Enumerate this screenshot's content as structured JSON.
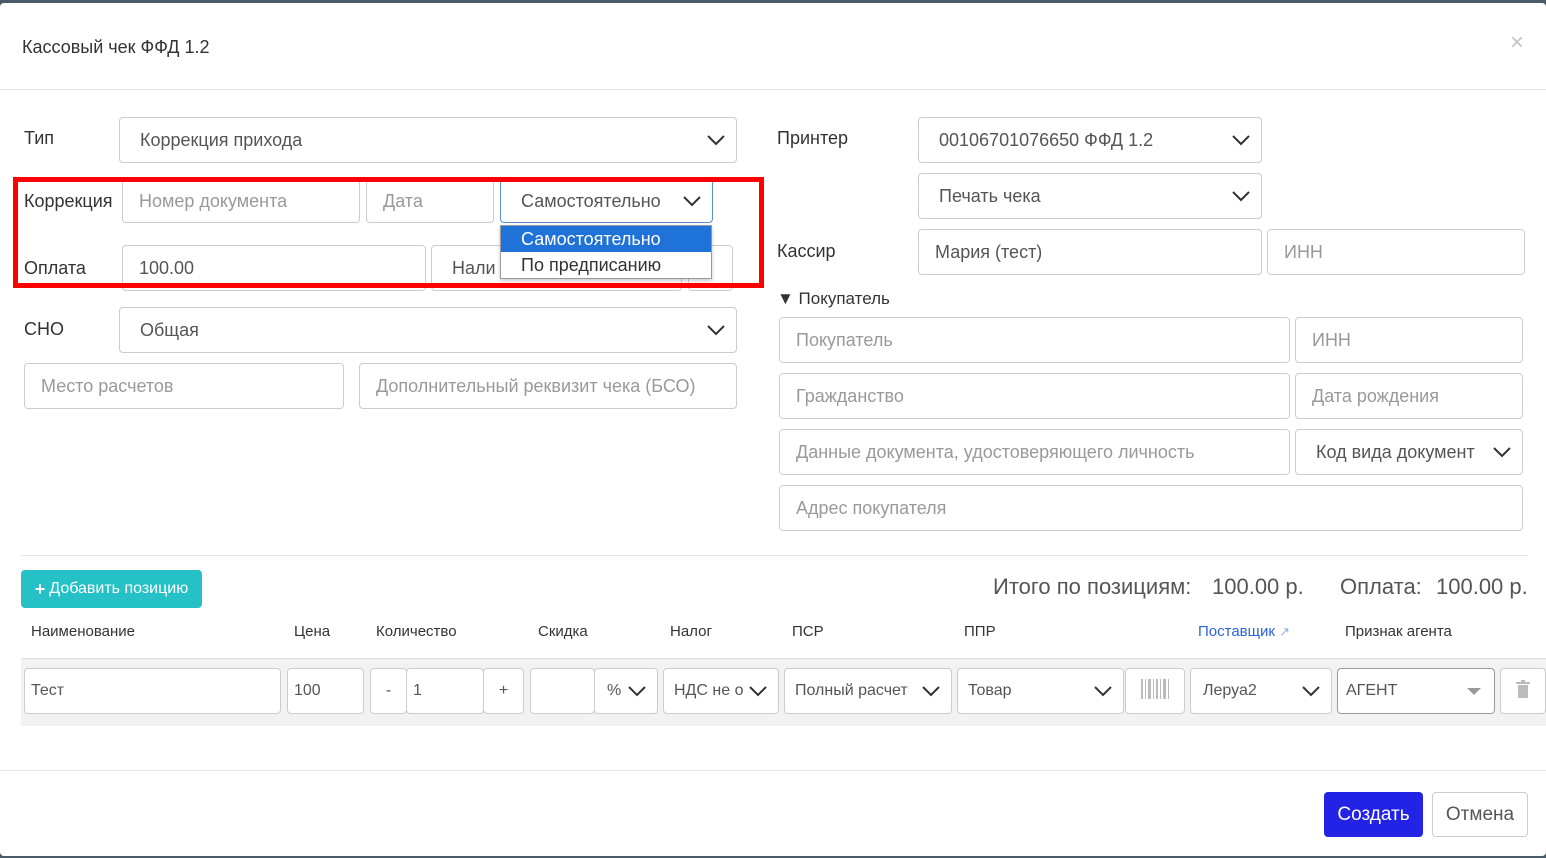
{
  "modal": {
    "title": "Кассовый чек ФФД 1.2",
    "close_icon": "×"
  },
  "left": {
    "type_label": "Тип",
    "type_value": "Коррекция прихода",
    "correction_label": "Коррекция",
    "doc_number_placeholder": "Номер документа",
    "date_placeholder": "Дата",
    "correction_kind_value": "Самостоятельно",
    "payment_label": "Оплата",
    "payment_amount": "100.00",
    "payment_method_partial": "Нали",
    "sno_label": "СНО",
    "sno_value": "Общая",
    "place_placeholder": "Место расчетов",
    "extra_placeholder": "Дополнительный реквизит чека (БСО)"
  },
  "dropdown": {
    "options": [
      "Самостоятельно",
      "По предписанию"
    ],
    "selected_index": 0
  },
  "right": {
    "printer_label": "Принтер",
    "printer_value": "00106701076650 ФФД 1.2",
    "mode_value": "Печать чека",
    "cashier_label": "Кассир",
    "cashier_value": "Мария (тест)",
    "cashier_inn_placeholder": "ИНН",
    "buyer_toggle": "▼ Покупатель",
    "buyer_placeholder": "Покупатель",
    "buyer_inn_placeholder": "ИНН",
    "citizenship_placeholder": "Гражданство",
    "birthdate_placeholder": "Дата рождения",
    "id_doc_placeholder": "Данные документа, удостоверяющего личность",
    "doc_kind_value": "Код вида документ",
    "address_placeholder": "Адрес покупателя"
  },
  "positions": {
    "add_button": "Добавить позицию",
    "total_label": "Итого по позициям:",
    "total_value": "100.00 р.",
    "payment_label": "Оплата:",
    "payment_value": "100.00 р.",
    "headers": {
      "name": "Наименование",
      "price": "Цена",
      "qty": "Количество",
      "discount": "Скидка",
      "tax": "Налог",
      "psr": "ПСР",
      "ppr": "ППР",
      "supplier": "Поставщик",
      "agent": "Признак агента"
    },
    "row": {
      "name": "Тест",
      "price": "100",
      "qty_minus": "-",
      "qty": "1",
      "qty_plus": "+",
      "discount": "",
      "discount_unit": "%",
      "tax": "НДС не о",
      "psr": "Полный расчет",
      "ppr": "Товар",
      "supplier": "Леруа2",
      "agent": "АГЕНТ"
    }
  },
  "footer": {
    "create": "Создать",
    "cancel": "Отмена"
  },
  "colors": {
    "highlight_border": "#ff0000",
    "add_button_bg": "#25c1c6",
    "create_button_bg": "#2323e6",
    "dropdown_selected": "#1e72d8",
    "link": "#2b63e0"
  }
}
